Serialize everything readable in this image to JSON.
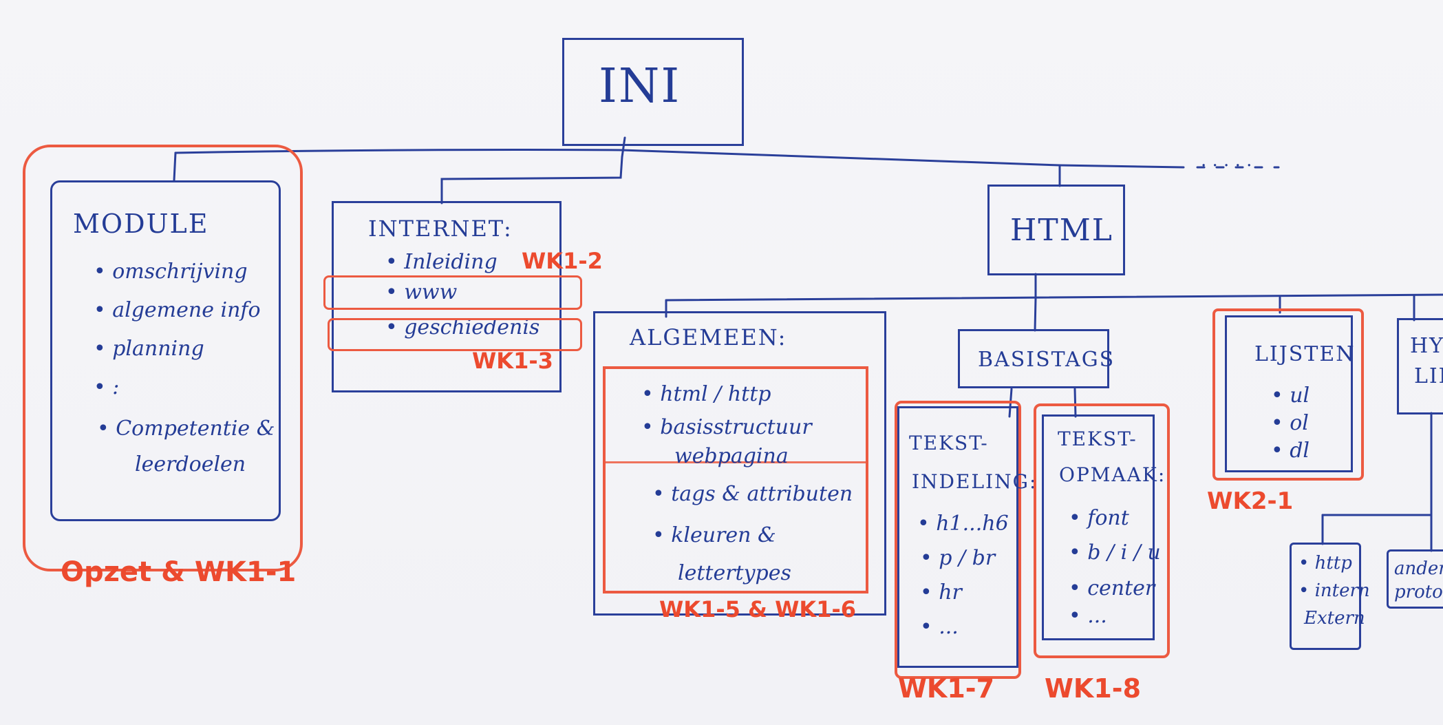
{
  "root": {
    "label": "INI"
  },
  "ellipsis_top": ". . . . .",
  "module": {
    "title": "MODULE",
    "items": [
      "• omschrijving",
      "• algemene info",
      "• planning",
      "• :",
      "• Competentie &",
      "leerdoelen"
    ],
    "tag": "Opzet & WK1-1"
  },
  "internet": {
    "title": "INTERNET:",
    "items": [
      "• Inleiding",
      "• www",
      "• geschiedenis"
    ],
    "tag_wk12": "WK1-2",
    "tag_wk13": "WK1-3"
  },
  "html": {
    "label": "HTML"
  },
  "algemeen": {
    "title": "ALGEMEEN:",
    "items": [
      "• html / http",
      "• basisstructuur",
      "webpagina",
      "• tags & attributen",
      "• kleuren &",
      "lettertypes"
    ],
    "tag": "WK1-5 & WK1-6"
  },
  "basistags": {
    "label": "BASISTAGS"
  },
  "tekstindeling": {
    "title_1": "TEKST-",
    "title_2": "INDELING:",
    "items": [
      "• h1...h6",
      "• p / br",
      "• hr",
      "• ..."
    ],
    "tag": "WK1-7"
  },
  "tekstopmaak": {
    "title_1": "TEKST-",
    "title_2": "OPMAAK:",
    "items": [
      "• font",
      "• b / i / u",
      "• center",
      "• ..."
    ],
    "tag": "WK1-8"
  },
  "lijsten": {
    "title": "LIJSTEN",
    "items": [
      "• ul",
      "• ol",
      "• dl"
    ],
    "tag": "WK2-1"
  },
  "hyperlinks": {
    "title_1": "HYP",
    "title_2": "LIN"
  },
  "http_box": {
    "items": [
      "• http",
      "• intern",
      "Extern"
    ]
  },
  "andere_box": {
    "items": [
      "andere",
      "protocol"
    ]
  },
  "colors": {
    "ink_blue": "#243c96",
    "ink_red": "#ec4a2e",
    "paper": "#f4f4f7"
  }
}
